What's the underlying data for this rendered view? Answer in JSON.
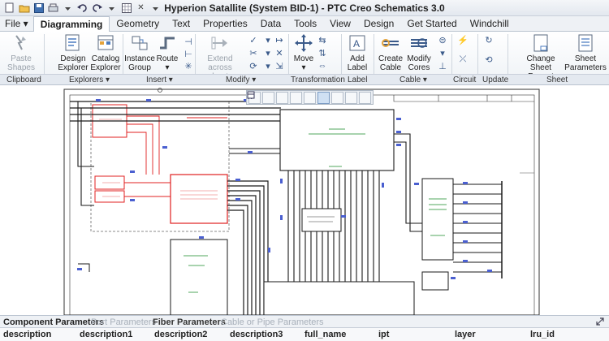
{
  "window": {
    "title": "Hyperion Satallite (System BID-1) - PTC Creo Schematics 3.0",
    "close_glyph": "✕"
  },
  "tabs": [
    {
      "label": "File ▾"
    },
    {
      "label": "Diagramming"
    },
    {
      "label": "Geometry"
    },
    {
      "label": "Text"
    },
    {
      "label": "Properties"
    },
    {
      "label": "Data"
    },
    {
      "label": "Tools"
    },
    {
      "label": "View"
    },
    {
      "label": "Design"
    },
    {
      "label": "Get Started"
    },
    {
      "label": "Windchill"
    }
  ],
  "ribbon": {
    "paste_shapes": [
      "Paste",
      "Shapes ▾"
    ],
    "design_explorer": [
      "Design",
      "Explorer"
    ],
    "catalog_explorer": [
      "Catalog",
      "Explorer"
    ],
    "instance_group": [
      "Instance",
      "Group"
    ],
    "route": [
      "Route",
      "▾"
    ],
    "extend": [
      "Extend",
      "across sheets"
    ],
    "move": [
      "Move",
      "▾"
    ],
    "add_label": [
      "Add",
      "Label ▾"
    ],
    "create_cable": [
      "Create",
      "Cable"
    ],
    "modify_cores": [
      "Modify",
      "Cores ▾"
    ],
    "change_sheet_format": [
      "Change",
      "Sheet Format"
    ],
    "sheet_parameters": [
      "Sheet",
      "Parameters"
    ]
  },
  "groups": [
    {
      "label": "Clipboard"
    },
    {
      "label": "Explorers ▾"
    },
    {
      "label": "Insert ▾"
    },
    {
      "label": "Modify ▾"
    },
    {
      "label": "Transformation"
    },
    {
      "label": "Label"
    },
    {
      "label": "Cable ▾"
    },
    {
      "label": "Circuit"
    },
    {
      "label": "Update"
    },
    {
      "label": "Sheet"
    }
  ],
  "panel_tabs": [
    {
      "label": "Component Parameters"
    },
    {
      "label": "Port Parameters"
    },
    {
      "label": "Fiber Parameters"
    },
    {
      "label": "Cable or Pipe Parameters"
    }
  ],
  "columns": [
    {
      "label": "description"
    },
    {
      "label": "description1"
    },
    {
      "label": "description2"
    },
    {
      "label": "description3"
    },
    {
      "label": "full_name"
    },
    {
      "label": "ipt"
    },
    {
      "label": "layer"
    },
    {
      "label": "lru_id"
    }
  ],
  "colors": {
    "accent": "#2f6db3",
    "wire": "#1a1a1a",
    "selected": "#e02020",
    "component_green": "#1a8a2a",
    "connector_blue": "#4a5fd0"
  }
}
